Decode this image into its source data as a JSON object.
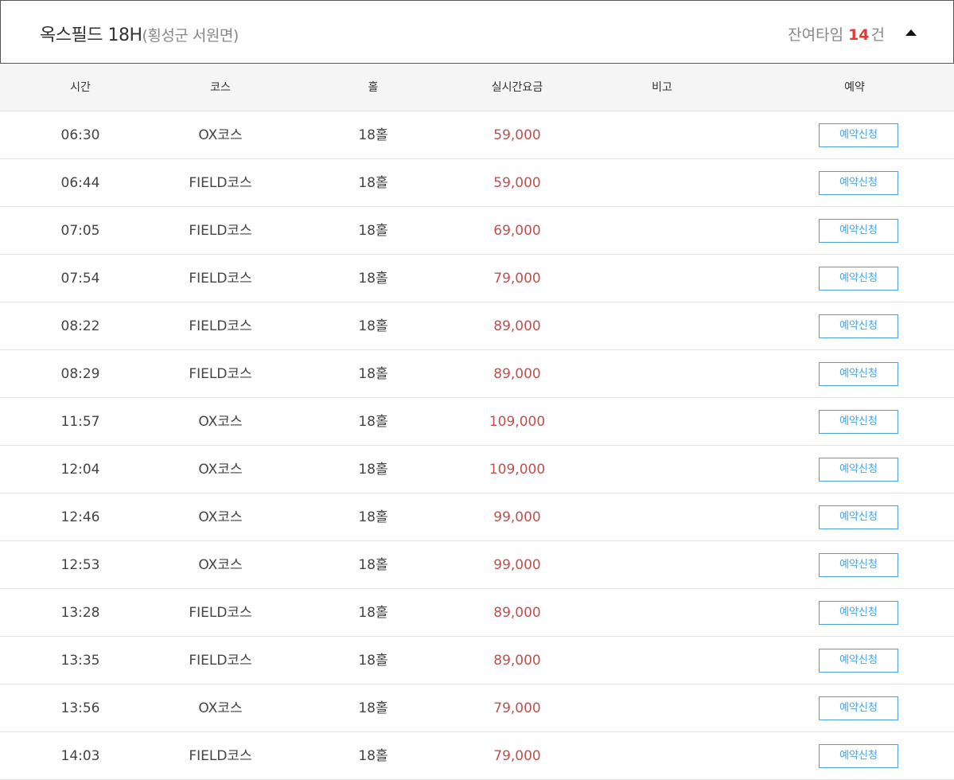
{
  "header": {
    "title": "옥스필드 18H",
    "region": "(횡성군 서원면)",
    "remaining_label": "잔여타임",
    "remaining_count": "14",
    "remaining_unit": "건",
    "collapse_icon": "caret-up-icon"
  },
  "table": {
    "columns": {
      "time": "시간",
      "course": "코스",
      "hole": "홀",
      "price": "실시간요금",
      "note": "비고",
      "book": "예약"
    },
    "reserve_label": "예약신청",
    "rows": [
      {
        "time": "06:30",
        "course": "OX코스",
        "hole": "18홀",
        "price": "59,000",
        "note": ""
      },
      {
        "time": "06:44",
        "course": "FIELD코스",
        "hole": "18홀",
        "price": "59,000",
        "note": ""
      },
      {
        "time": "07:05",
        "course": "FIELD코스",
        "hole": "18홀",
        "price": "69,000",
        "note": ""
      },
      {
        "time": "07:54",
        "course": "FIELD코스",
        "hole": "18홀",
        "price": "79,000",
        "note": ""
      },
      {
        "time": "08:22",
        "course": "FIELD코스",
        "hole": "18홀",
        "price": "89,000",
        "note": ""
      },
      {
        "time": "08:29",
        "course": "FIELD코스",
        "hole": "18홀",
        "price": "89,000",
        "note": ""
      },
      {
        "time": "11:57",
        "course": "OX코스",
        "hole": "18홀",
        "price": "109,000",
        "note": ""
      },
      {
        "time": "12:04",
        "course": "OX코스",
        "hole": "18홀",
        "price": "109,000",
        "note": ""
      },
      {
        "time": "12:46",
        "course": "OX코스",
        "hole": "18홀",
        "price": "99,000",
        "note": ""
      },
      {
        "time": "12:53",
        "course": "OX코스",
        "hole": "18홀",
        "price": "99,000",
        "note": ""
      },
      {
        "time": "13:28",
        "course": "FIELD코스",
        "hole": "18홀",
        "price": "89,000",
        "note": ""
      },
      {
        "time": "13:35",
        "course": "FIELD코스",
        "hole": "18홀",
        "price": "89,000",
        "note": ""
      },
      {
        "time": "13:56",
        "course": "OX코스",
        "hole": "18홀",
        "price": "79,000",
        "note": ""
      },
      {
        "time": "14:03",
        "course": "FIELD코스",
        "hole": "18홀",
        "price": "79,000",
        "note": ""
      }
    ]
  },
  "colors": {
    "price": "#c0504d",
    "count": "#e53935",
    "button": "#4aa3d8",
    "header_bg": "#f5f5f5"
  }
}
